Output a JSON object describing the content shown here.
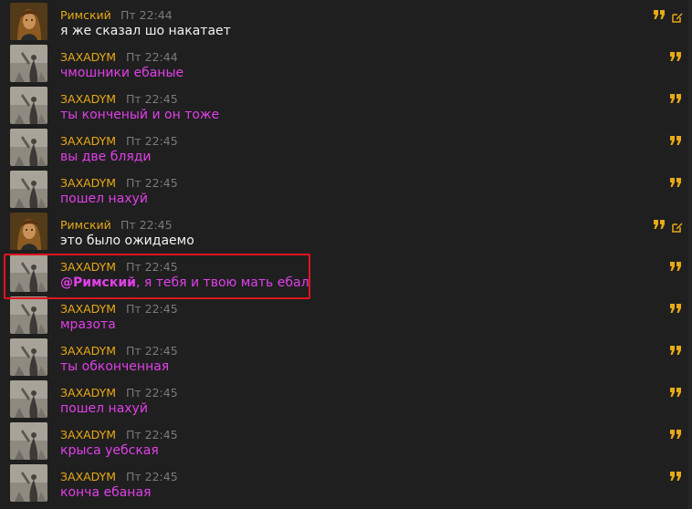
{
  "colors": {
    "background": "#1f1f1f",
    "name_accent": "#e8a917",
    "white_text": "#f2f2f2",
    "magenta_text": "#e040e8",
    "timestamp": "#7a7a7a",
    "highlight_border": "#e0141e"
  },
  "messages": [
    {
      "author": "Римский",
      "time": "Пт 22:44",
      "text": "я же сказал шо накатает",
      "text_color": "white",
      "avatar": "romsky",
      "own": true
    },
    {
      "author": "ЗАХАDYМ",
      "time": "Пт 22:44",
      "text": "чмошники ебаные",
      "text_color": "magenta",
      "avatar": "zaxadym",
      "own": false
    },
    {
      "author": "ЗАХАDYМ",
      "time": "Пт 22:45",
      "text": "ты конченый и он тоже",
      "text_color": "magenta",
      "avatar": "zaxadym",
      "own": false
    },
    {
      "author": "ЗАХАDYМ",
      "time": "Пт 22:45",
      "text": "вы две бляди",
      "text_color": "magenta",
      "avatar": "zaxadym",
      "own": false
    },
    {
      "author": "ЗАХАDYМ",
      "time": "Пт 22:45",
      "text": "пошел нахуй",
      "text_color": "magenta",
      "avatar": "zaxadym",
      "own": false
    },
    {
      "author": "Римский",
      "time": "Пт 22:45",
      "text": "это было ожидаемо",
      "text_color": "white",
      "avatar": "romsky",
      "own": true
    },
    {
      "author": "ЗАХАDYМ",
      "time": "Пт 22:45",
      "mention": "@Римский",
      "text": ", я тебя и твою мать ебал",
      "text_color": "magenta",
      "avatar": "zaxadym",
      "own": false,
      "highlighted": true
    },
    {
      "author": "ЗАХАDYМ",
      "time": "Пт 22:45",
      "text": "мразота",
      "text_color": "magenta",
      "avatar": "zaxadym",
      "own": false
    },
    {
      "author": "ЗАХАDYМ",
      "time": "Пт 22:45",
      "text": "ты обконченная",
      "text_color": "magenta",
      "avatar": "zaxadym",
      "own": false
    },
    {
      "author": "ЗАХАDYМ",
      "time": "Пт 22:45",
      "text": "пошел нахуй",
      "text_color": "magenta",
      "avatar": "zaxadym",
      "own": false
    },
    {
      "author": "ЗАХАDYМ",
      "time": "Пт 22:45",
      "text": "крыса уебская",
      "text_color": "magenta",
      "avatar": "zaxadym",
      "own": false
    },
    {
      "author": "ЗАХАDYМ",
      "time": "Пт 22:45",
      "text": "конча ебаная",
      "text_color": "magenta",
      "avatar": "zaxadym",
      "own": false
    }
  ],
  "icons": {
    "quote": "quote-icon",
    "edit": "edit-icon"
  }
}
